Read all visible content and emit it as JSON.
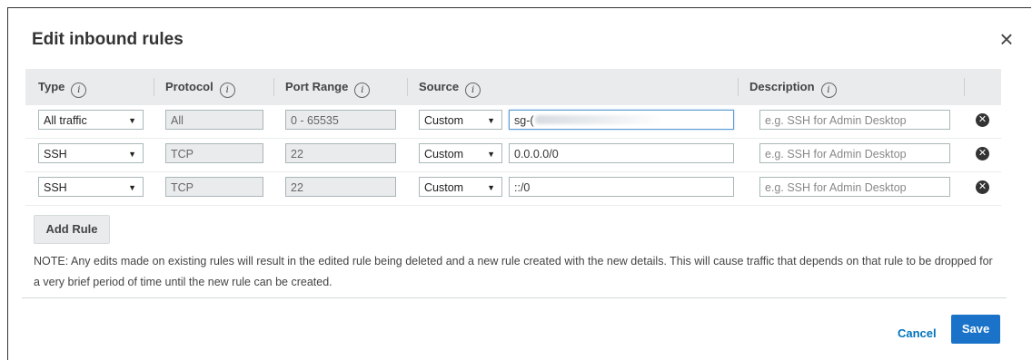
{
  "dialog": {
    "title": "Edit inbound rules",
    "close_glyph": "×"
  },
  "columns": {
    "type": "Type",
    "protocol": "Protocol",
    "port_range": "Port Range",
    "source": "Source",
    "description": "Description",
    "info_glyph": "i"
  },
  "rules": [
    {
      "type": "All traffic",
      "protocol": "All",
      "port_range": "0 - 65535",
      "source_type": "Custom",
      "source_value": "sg-(",
      "source_redacted": true,
      "description_placeholder": "e.g. SSH for Admin Desktop"
    },
    {
      "type": "SSH",
      "protocol": "TCP",
      "port_range": "22",
      "source_type": "Custom",
      "source_value": "0.0.0.0/0",
      "description_placeholder": "e.g. SSH for Admin Desktop"
    },
    {
      "type": "SSH",
      "protocol": "TCP",
      "port_range": "22",
      "source_type": "Custom",
      "source_value": "::/0",
      "description_placeholder": "e.g. SSH for Admin Desktop"
    }
  ],
  "add_rule_label": "Add Rule",
  "note": "NOTE: Any edits made on existing rules will result in the edited rule being deleted and a new rule created with the new details. This will cause traffic that depends on that rule to be dropped for a very brief period of time until the new rule can be created.",
  "footer": {
    "cancel_label": "Cancel",
    "save_label": "Save"
  },
  "icons": {
    "dropdown_arrow": "▼",
    "remove": "✕"
  },
  "colors": {
    "primary_button": "#1a73c8",
    "link": "#0073bb",
    "header_bg": "#e9ebed"
  }
}
